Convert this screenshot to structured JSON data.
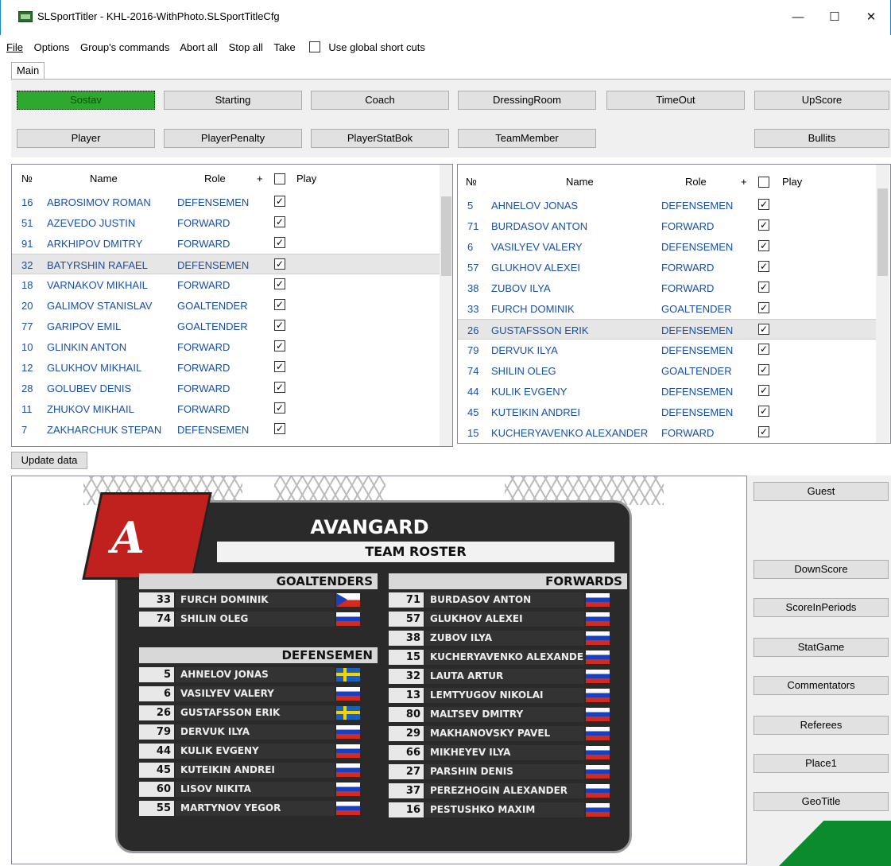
{
  "window": {
    "title": "SLSportTitler - KHL-2016-WithPhoto.SLSportTitleCfg",
    "minimize": "—",
    "maximize": "☐",
    "close": "✕"
  },
  "menu": {
    "file": "File",
    "options": "Options",
    "group": "Group's commands",
    "abort": "Abort all",
    "stop": "Stop all",
    "take": "Take",
    "global": "Use global short cuts"
  },
  "tab": {
    "main": "Main"
  },
  "buttons": {
    "sostav": "Sostav",
    "starting": "Starting",
    "coach": "Coach",
    "dressing": "DressingRoom",
    "timeout": "TimeOut",
    "upscore": "UpScore",
    "player": "Player",
    "playerpenalty": "PlayerPenalty",
    "playerstat": "PlayerStatBok",
    "teammember": "TeamMember",
    "bullits": "Bullits"
  },
  "grid_headers": {
    "num": "№",
    "name": "Name",
    "role": "Role",
    "plus": "+",
    "play": "Play"
  },
  "left_rows": [
    {
      "n": "16",
      "name": "ABROSIMOV ROMAN",
      "role": "DEFENSEMEN"
    },
    {
      "n": "51",
      "name": "AZEVEDO JUSTIN",
      "role": "FORWARD"
    },
    {
      "n": "91",
      "name": "ARKHIPOV DMITRY",
      "role": "FORWARD"
    },
    {
      "n": "32",
      "name": "BATYRSHIN RAFAEL",
      "role": "DEFENSEMEN"
    },
    {
      "n": "18",
      "name": "VARNAKOV MIKHAIL",
      "role": "FORWARD"
    },
    {
      "n": "20",
      "name": "GALIMOV STANISLAV",
      "role": "GOALTENDER"
    },
    {
      "n": "77",
      "name": "GARIPOV EMIL",
      "role": "GOALTENDER"
    },
    {
      "n": "10",
      "name": "GLINKIN ANTON",
      "role": "FORWARD"
    },
    {
      "n": "12",
      "name": "GLUKHOV MIKHAIL",
      "role": "FORWARD"
    },
    {
      "n": "28",
      "name": "GOLUBEV DENIS",
      "role": "FORWARD"
    },
    {
      "n": "11",
      "name": "ZHUKOV MIKHAIL",
      "role": "FORWARD"
    },
    {
      "n": "7",
      "name": "ZAKHARCHUK STEPAN",
      "role": "DEFENSEMEN"
    }
  ],
  "right_rows": [
    {
      "n": "5",
      "name": "AHNELOV JONAS",
      "role": "DEFENSEMEN"
    },
    {
      "n": "71",
      "name": "BURDASOV ANTON",
      "role": "FORWARD"
    },
    {
      "n": "6",
      "name": "VASILYEV VALERY",
      "role": "DEFENSEMEN"
    },
    {
      "n": "57",
      "name": "GLUKHOV ALEXEI",
      "role": "FORWARD"
    },
    {
      "n": "38",
      "name": "ZUBOV ILYA",
      "role": "FORWARD"
    },
    {
      "n": "33",
      "name": "FURCH DOMINIK",
      "role": "GOALTENDER"
    },
    {
      "n": "26",
      "name": "GUSTAFSSON ERIK",
      "role": "DEFENSEMEN"
    },
    {
      "n": "79",
      "name": "DERVUK ILYA",
      "role": "DEFENSEMEN"
    },
    {
      "n": "74",
      "name": "SHILIN OLEG",
      "role": "GOALTENDER"
    },
    {
      "n": "44",
      "name": "KULIK EVGENY",
      "role": "DEFENSEMEN"
    },
    {
      "n": "45",
      "name": "KUTEIKIN ANDREI",
      "role": "DEFENSEMEN"
    },
    {
      "n": "15",
      "name": "KUCHERYAVENKO ALEXANDER",
      "role": "FORWARD"
    }
  ],
  "update": "Update data",
  "right_buttons": [
    "Guest",
    "DownScore",
    "ScoreInPeriods",
    "StatGame",
    "Commentators",
    "Referees",
    "Place1",
    "GeoTitle"
  ],
  "preview": {
    "team": "AVANGARD",
    "subtitle": "TEAM ROSTER",
    "goaltenders_label": "GOALTENDERS",
    "defensemen_label": "DEFENSEMEN",
    "forwards_label": "FORWARDS",
    "goaltenders": [
      {
        "n": "33",
        "name": "FURCH DOMINIK",
        "flag": "cz"
      },
      {
        "n": "74",
        "name": "SHILIN OLEG",
        "flag": "ru"
      }
    ],
    "defensemen": [
      {
        "n": "5",
        "name": "AHNELOV JONAS",
        "flag": "se"
      },
      {
        "n": "6",
        "name": "VASILYEV VALERY",
        "flag": "ru"
      },
      {
        "n": "26",
        "name": "GUSTAFSSON ERIK",
        "flag": "se"
      },
      {
        "n": "79",
        "name": "DERVUK ILYA",
        "flag": "ru"
      },
      {
        "n": "44",
        "name": "KULIK EVGENY",
        "flag": "ru"
      },
      {
        "n": "45",
        "name": "KUTEIKIN ANDREI",
        "flag": "ru"
      },
      {
        "n": "60",
        "name": "LISOV NIKITA",
        "flag": "ru"
      },
      {
        "n": "55",
        "name": "MARTYNOV YEGOR",
        "flag": "ru"
      }
    ],
    "forwards": [
      {
        "n": "71",
        "name": "BURDASOV ANTON",
        "flag": "ru"
      },
      {
        "n": "57",
        "name": "GLUKHOV ALEXEI",
        "flag": "ru"
      },
      {
        "n": "38",
        "name": "ZUBOV ILYA",
        "flag": "ru"
      },
      {
        "n": "15",
        "name": "KUCHERYAVENKO ALEXANDER",
        "flag": "ru"
      },
      {
        "n": "32",
        "name": "LAUTA ARTUR",
        "flag": "ru"
      },
      {
        "n": "13",
        "name": "LEMTYUGOV NIKOLAI",
        "flag": "ru"
      },
      {
        "n": "80",
        "name": "MALTSEV DMITRY",
        "flag": "ru"
      },
      {
        "n": "29",
        "name": "MAKHANOVSKY PAVEL",
        "flag": "ru"
      },
      {
        "n": "66",
        "name": "MIKHEYEV ILYA",
        "flag": "ru"
      },
      {
        "n": "27",
        "name": "PARSHIN DENIS",
        "flag": "ru"
      },
      {
        "n": "37",
        "name": "PEREZHOGIN ALEXANDER",
        "flag": "ru"
      },
      {
        "n": "16",
        "name": "PESTUSHKO MAXIM",
        "flag": "ru"
      }
    ]
  }
}
